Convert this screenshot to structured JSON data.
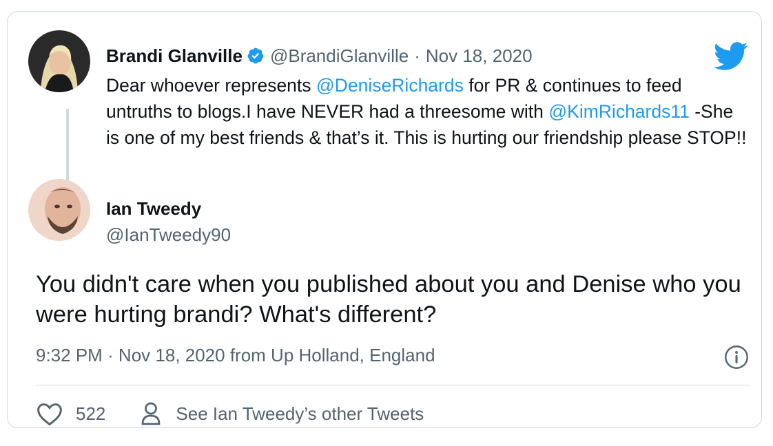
{
  "quoted_tweet": {
    "name": "Brandi Glanville",
    "handle": "@BrandiGlanville",
    "separator": "·",
    "date": "Nov 18, 2020",
    "text_1": "Dear whoever represents ",
    "mention_1": "@DeniseRichards",
    "text_2": " for PR & continues to feed untruths to blogs.I have NEVER  had a threesome with ",
    "mention_2": "@KimRichards11",
    "text_3": " -She is one of my best friends & that’s it. This is hurting our friendship please STOP!!"
  },
  "reply": {
    "name": "Ian Tweedy",
    "handle": "@IanTweedy90",
    "text": "You didn't care when you published about you and Denise who you were hurting brandi? What's different?",
    "meta": "9:32 PM · Nov 18, 2020 from Up Holland, England"
  },
  "actions": {
    "like_count": "522",
    "other_tweets_label": "See Ian Tweedy’s other Tweets"
  },
  "icons": {
    "brand": "twitter-bird-icon",
    "verified": "verified-badge-icon",
    "info": "info-icon",
    "like": "heart-icon",
    "profile": "person-icon"
  },
  "colors": {
    "accent": "#1d9bf0",
    "secondary_text": "#536471",
    "border": "#cfd9de",
    "text": "#0f1419"
  }
}
